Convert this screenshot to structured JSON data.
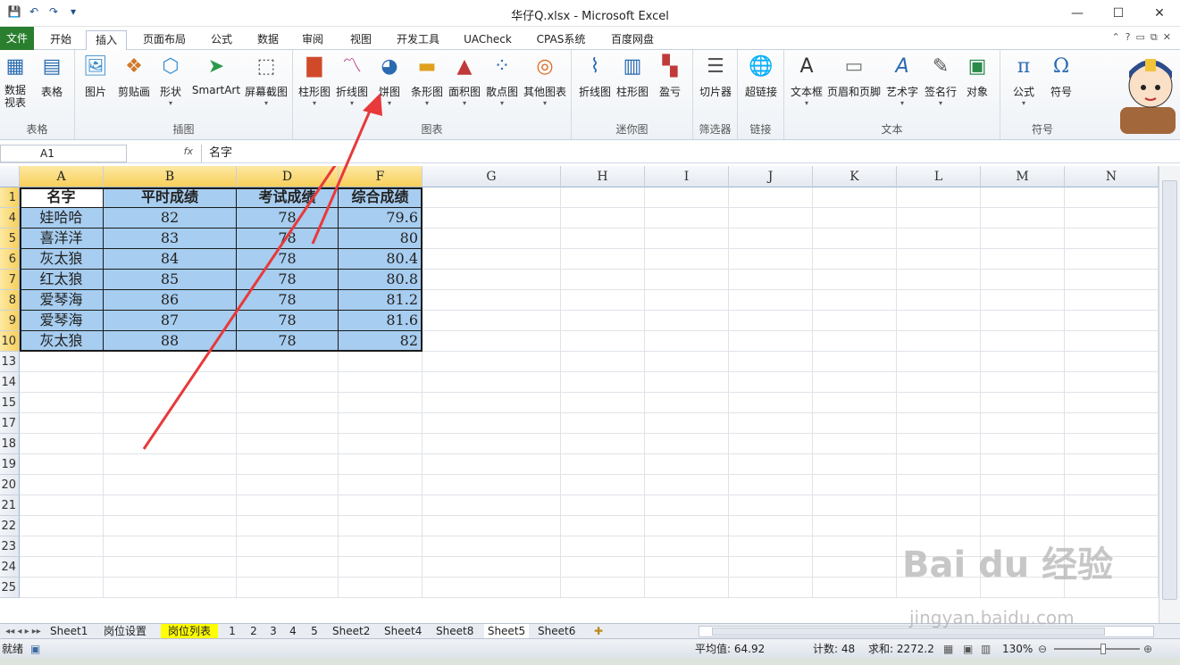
{
  "window": {
    "title": "华仔Q.xlsx - Microsoft Excel",
    "qat_icons": [
      "save-icon",
      "undo-icon",
      "redo-icon",
      "customize-icon"
    ],
    "controls": [
      "—",
      "☐",
      "✕"
    ]
  },
  "tabs": [
    "文件",
    "开始",
    "插入",
    "页面布局",
    "公式",
    "数据",
    "审阅",
    "视图",
    "开发工具",
    "UACheck",
    "CPAS系统",
    "百度网盘"
  ],
  "ribbon": {
    "groups": [
      {
        "label": "表格",
        "buttons": [
          "数据\n视表",
          "表格"
        ]
      },
      {
        "label": "插图",
        "buttons": [
          "图片",
          "剪贴画",
          "形状",
          "SmartArt",
          "屏幕截图"
        ]
      },
      {
        "label": "图表",
        "buttons": [
          "柱形图",
          "折线图",
          "饼图",
          "条形图",
          "面积图",
          "散点图",
          "其他图表"
        ]
      },
      {
        "label": "迷你图",
        "buttons": [
          "折线图",
          "柱形图",
          "盈亏"
        ]
      },
      {
        "label": "筛选器",
        "buttons": [
          "切片器"
        ]
      },
      {
        "label": "链接",
        "buttons": [
          "超链接"
        ]
      },
      {
        "label": "文本",
        "buttons": [
          "文本框",
          "页眉和页脚",
          "艺术字",
          "签名行",
          "对象"
        ]
      },
      {
        "label": "符号",
        "buttons": [
          "公式",
          "符号"
        ]
      }
    ]
  },
  "formula_bar": {
    "name_box": "A1",
    "fx": "fx",
    "content": "名字"
  },
  "columns": [
    "A",
    "B",
    "D",
    "F",
    "G",
    "H",
    "I",
    "J",
    "K",
    "L",
    "M",
    "N"
  ],
  "rows": [
    "1",
    "4",
    "5",
    "6",
    "7",
    "8",
    "9",
    "10",
    "13",
    "14",
    "15",
    "17",
    "18",
    "19",
    "20",
    "21",
    "22",
    "23",
    "24",
    "25"
  ],
  "table": {
    "headers": [
      "名字",
      "平时成绩",
      "考试成绩",
      "综合成绩"
    ],
    "rows": [
      [
        "娃哈哈",
        "82",
        "78",
        "79.6"
      ],
      [
        "喜洋洋",
        "83",
        "78",
        "80"
      ],
      [
        "灰太狼",
        "84",
        "78",
        "80.4"
      ],
      [
        "红太狼",
        "85",
        "78",
        "80.8"
      ],
      [
        "爱琴海",
        "86",
        "78",
        "81.2"
      ],
      [
        "爱琴海",
        "87",
        "78",
        "81.6"
      ],
      [
        "灰太狼",
        "88",
        "78",
        "82"
      ]
    ]
  },
  "sheets": [
    "Sheet1",
    "岗位设置",
    "岗位列表",
    "1",
    "2",
    "3",
    "4",
    "5",
    "Sheet2",
    "Sheet4",
    "Sheet8",
    "Sheet5",
    "Sheet6"
  ],
  "active_sheet": "Sheet5",
  "status": {
    "ready": "就绪",
    "average": "平均值: 64.92",
    "count": "计数: 48",
    "sum": "求和: 2272.2",
    "zoom": "130%"
  },
  "watermark": {
    "brand": "Bai du 经验",
    "url": "jingyan.baidu.com"
  },
  "colors": {
    "selection_fill": "#a7cdf0",
    "file_tab": "#2a7f2e",
    "arrow": "#e8393b"
  }
}
